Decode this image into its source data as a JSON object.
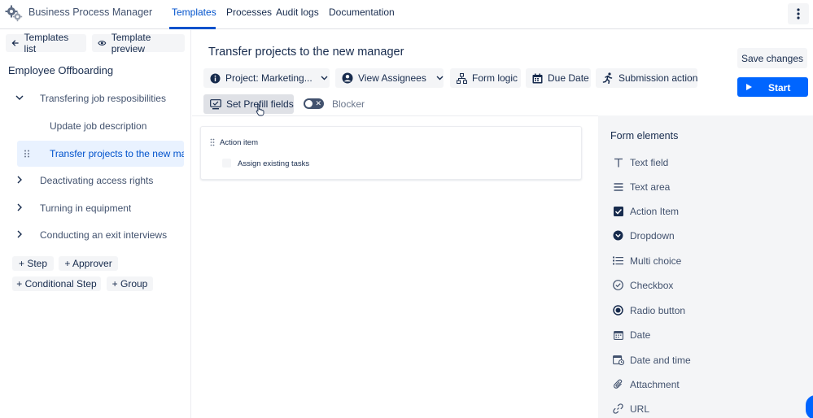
{
  "app": {
    "name": "Business Process Manager"
  },
  "nav": {
    "tabs": [
      "Templates",
      "Processes",
      "Audit logs",
      "Documentation"
    ]
  },
  "left": {
    "templates_list_label": "Templates list",
    "template_preview_label": "Template preview",
    "workflow_title": "Employee Offboarding",
    "tree": [
      {
        "label": "Transfering job resposibilities",
        "expanded": true
      },
      {
        "label": "Update job description",
        "child": true
      },
      {
        "label": "Transfer projects to the new manager",
        "child": true,
        "selected": true
      },
      {
        "label": "Deactivating access rights"
      },
      {
        "label": "Turning in equipment"
      },
      {
        "label": "Conducting an exit interviews"
      }
    ],
    "add_step": "+ Step",
    "add_approver": "+ Approver",
    "add_conditional_step": "+ Conditional Step",
    "add_group": "+ Group"
  },
  "header": {
    "title": "Transfer projects to the new manager",
    "project_label": "Project: Marketing...",
    "view_assignees": "View Assignees",
    "form_logic": "Form logic",
    "due_date": "Due Date",
    "submission_action": "Submission action",
    "set_prefill": "Set Prefill fields",
    "blocker": "Blocker",
    "save_changes": "Save changes",
    "start": "Start"
  },
  "canvas": {
    "card_title": "Action item",
    "card_item": "Assign existing tasks"
  },
  "form_elements": {
    "title": "Form elements",
    "items": [
      {
        "label": "Text field",
        "icon": "text-field-icon"
      },
      {
        "label": "Text area",
        "icon": "text-area-icon"
      },
      {
        "label": "Action Item",
        "icon": "action-item-icon"
      },
      {
        "label": "Dropdown",
        "icon": "dropdown-icon"
      },
      {
        "label": "Multi choice",
        "icon": "multi-choice-icon"
      },
      {
        "label": "Checkbox",
        "icon": "checkbox-icon"
      },
      {
        "label": "Radio button",
        "icon": "radio-button-icon"
      },
      {
        "label": "Date",
        "icon": "date-icon"
      },
      {
        "label": "Date and time",
        "icon": "date-time-icon"
      },
      {
        "label": "Attachment",
        "icon": "attachment-icon"
      },
      {
        "label": "URL",
        "icon": "url-icon"
      }
    ]
  },
  "colors": {
    "accent": "#0052cc",
    "primary_button": "#0065ff",
    "panel_bg": "#f4f5f7"
  }
}
